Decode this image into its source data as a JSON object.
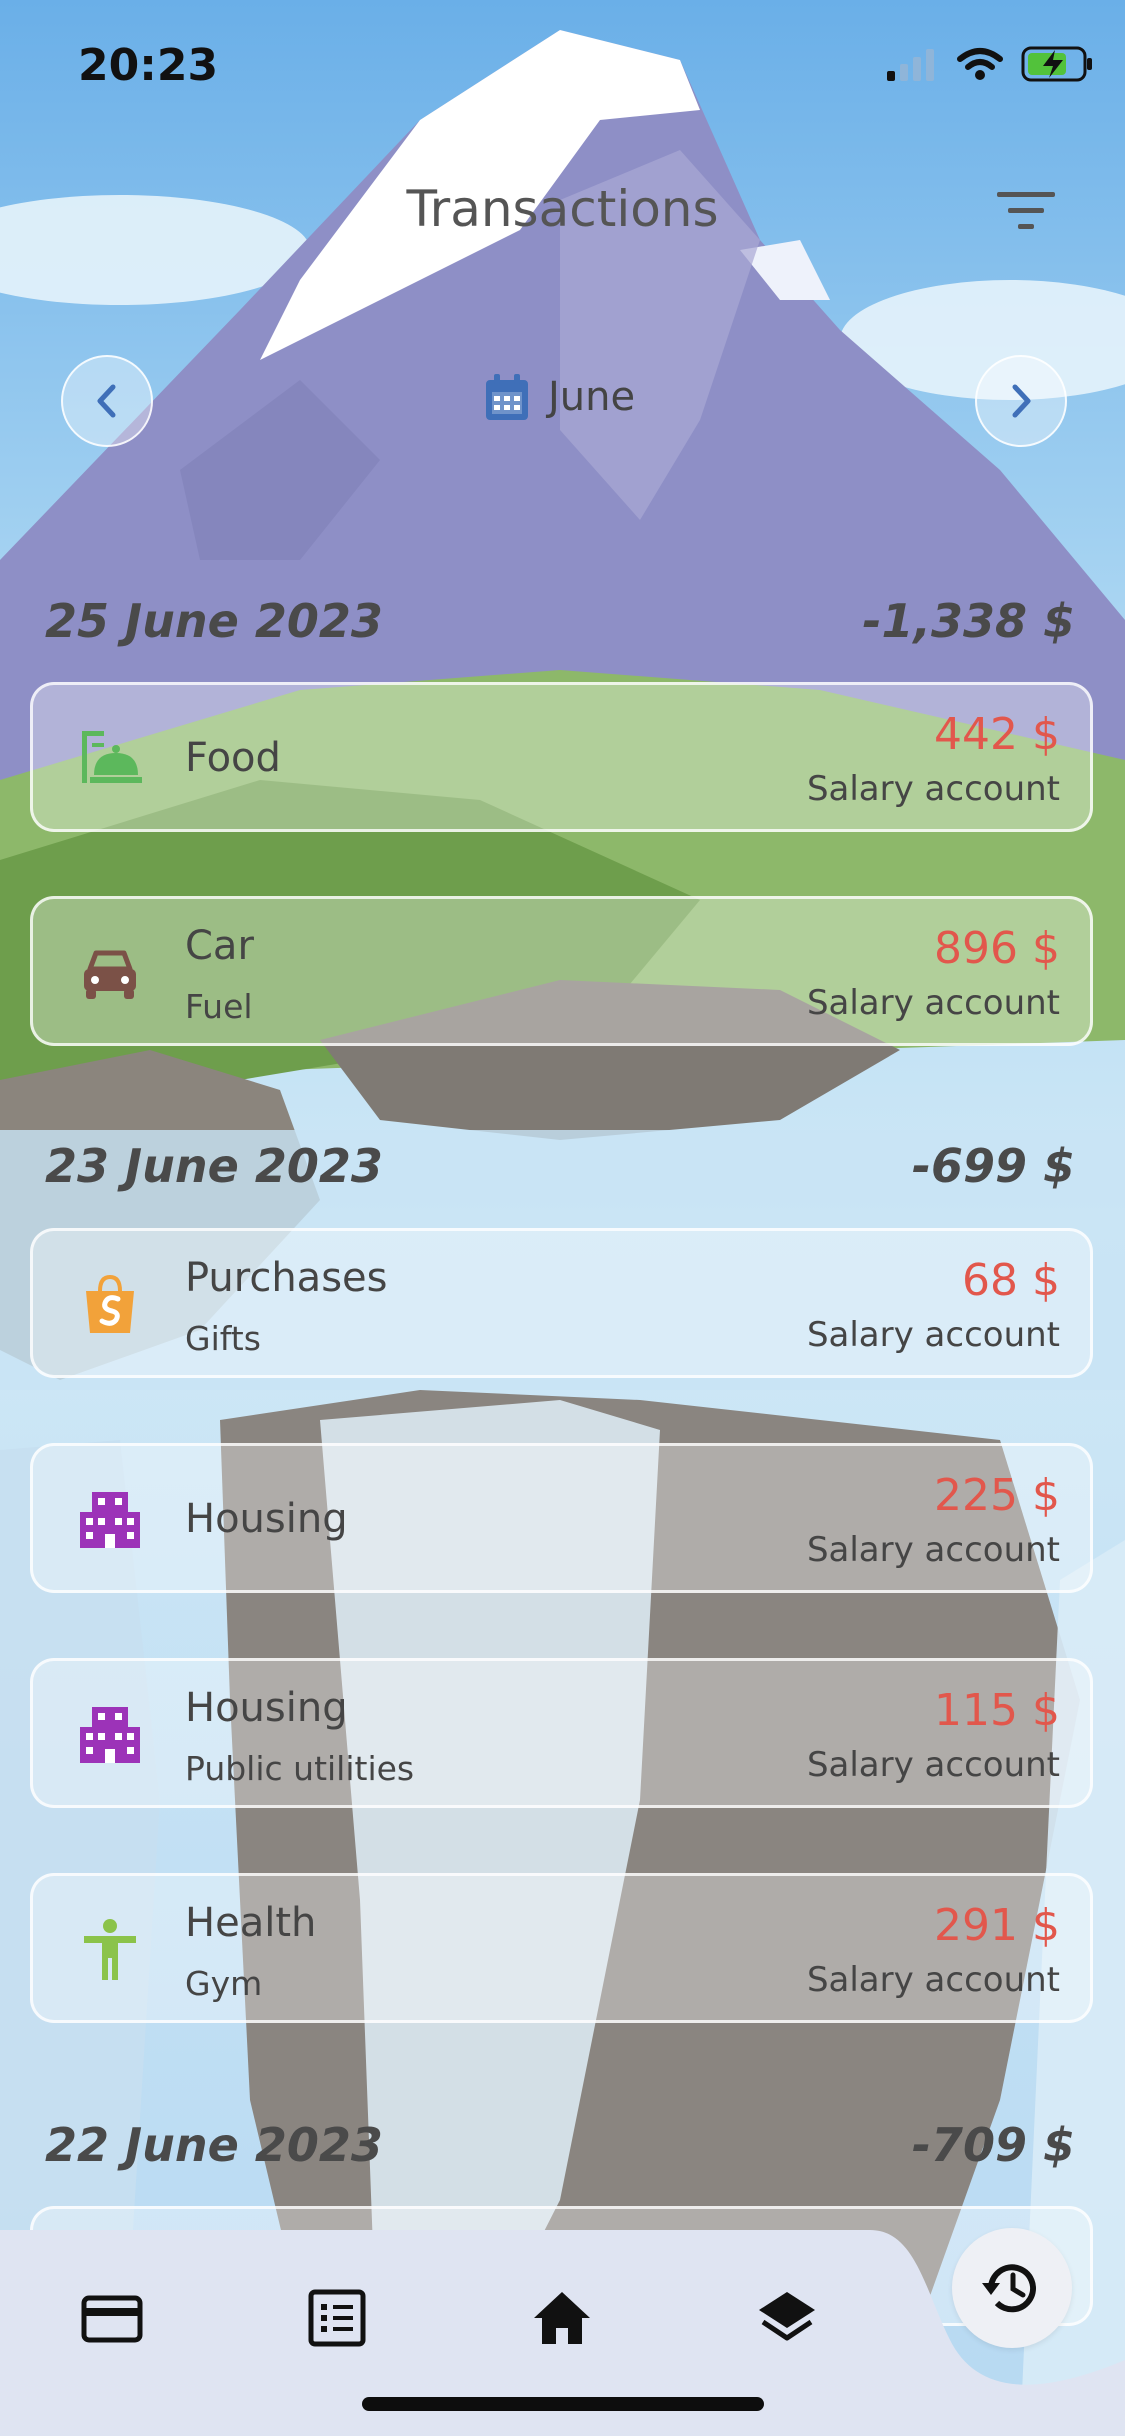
{
  "status_bar": {
    "time": "20:23"
  },
  "header": {
    "title": "Transactions"
  },
  "month_selector": {
    "label": "June"
  },
  "days": [
    {
      "date": "25 June 2023",
      "total": "-1,338 $",
      "transactions": [
        {
          "icon": "food-icon",
          "category": "Food",
          "subcategory": "",
          "amount": "442 $",
          "account": "Salary account"
        },
        {
          "icon": "car-icon",
          "category": "Car",
          "subcategory": "Fuel",
          "amount": "896 $",
          "account": "Salary account"
        }
      ]
    },
    {
      "date": "23 June 2023",
      "total": "-699 $",
      "transactions": [
        {
          "icon": "shopping-bag-icon",
          "category": "Purchases",
          "subcategory": "Gifts",
          "amount": "68 $",
          "account": "Salary account"
        },
        {
          "icon": "building-icon",
          "category": "Housing",
          "subcategory": "",
          "amount": "225 $",
          "account": "Salary account"
        },
        {
          "icon": "building-icon",
          "category": "Housing",
          "subcategory": "Public utilities",
          "amount": "115 $",
          "account": "Salary account"
        },
        {
          "icon": "person-icon",
          "category": "Health",
          "subcategory": "Gym",
          "amount": "291 $",
          "account": "Salary account"
        }
      ]
    },
    {
      "date": "22 June 2023",
      "total": "-709 $",
      "transactions": []
    }
  ],
  "tab_bar": {
    "tabs": [
      {
        "icon": "credit-card-icon"
      },
      {
        "icon": "list-icon"
      },
      {
        "icon": "home-icon"
      },
      {
        "icon": "layers-icon"
      }
    ],
    "fab_icon": "history-icon"
  },
  "colors": {
    "amount": "#e2574c",
    "food": "#5cb85c",
    "car": "#7b5147",
    "purchases": "#f2a23a",
    "housing": "#9c33b8",
    "health": "#8bc34a",
    "accent": "#3f6fb8"
  }
}
